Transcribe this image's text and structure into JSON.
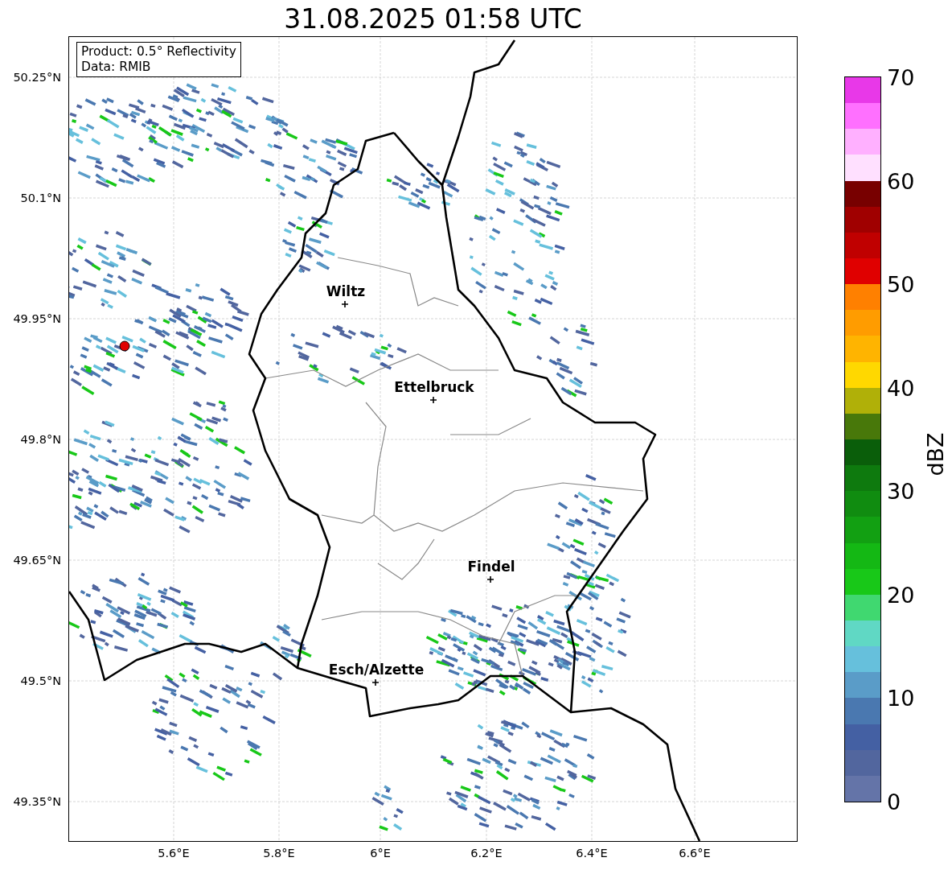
{
  "title": "31.08.2025 01:58 UTC",
  "info_box": [
    "Product: 0.5° Reflectivity",
    "Data: RMIB"
  ],
  "y_ticks": [
    "50.25°N",
    "50.1°N",
    "49.95°N",
    "49.8°N",
    "49.65°N",
    "49.5°N",
    "49.35°N"
  ],
  "x_ticks": [
    "5.6°E",
    "5.8°E",
    "6°E",
    "6.2°E",
    "6.4°E",
    "6.6°E"
  ],
  "cities": [
    {
      "name": "Wiltz"
    },
    {
      "name": "Ettelbruck"
    },
    {
      "name": "Findel"
    },
    {
      "name": "Esch/Alzette"
    }
  ],
  "colorbar": {
    "label": "dBZ",
    "ticks": [
      "70",
      "60",
      "50",
      "40",
      "30",
      "20",
      "10",
      "0"
    ],
    "bins": [
      {
        "color": "#6474a8"
      },
      {
        "color": "#52669e"
      },
      {
        "color": "#4460a3"
      },
      {
        "color": "#4a78b0"
      },
      {
        "color": "#5a9cc8"
      },
      {
        "color": "#66c0dc"
      },
      {
        "color": "#60d8c4"
      },
      {
        "color": "#40d870"
      },
      {
        "color": "#18c818"
      },
      {
        "color": "#14b814"
      },
      {
        "color": "#12a012"
      },
      {
        "color": "#108c10"
      },
      {
        "color": "#0e7a0e"
      },
      {
        "color": "#0a5e0a"
      },
      {
        "color": "#48780a"
      },
      {
        "color": "#b0b008"
      },
      {
        "color": "#ffd800"
      },
      {
        "color": "#ffb400"
      },
      {
        "color": "#ff9c00"
      },
      {
        "color": "#ff8000"
      },
      {
        "color": "#e00000"
      },
      {
        "color": "#c00000"
      },
      {
        "color": "#a00000"
      },
      {
        "color": "#780000"
      },
      {
        "color": "#ffe0ff"
      },
      {
        "color": "#ffb0ff"
      },
      {
        "color": "#ff70ff"
      },
      {
        "color": "#e838e8"
      }
    ]
  }
}
